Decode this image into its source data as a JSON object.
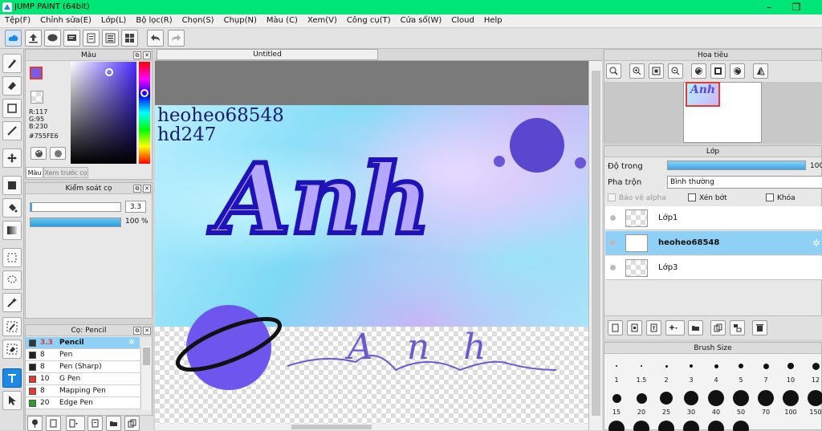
{
  "window": {
    "title": "JUMP PAINT (64bit)",
    "minimize": "–",
    "restore": "❐",
    "close": "✕"
  },
  "menu": [
    "Tệp(F)",
    "Chỉnh sửa(E)",
    "Lớp(L)",
    "Bộ lọc(R)",
    "Chọn(S)",
    "Chụp(N)",
    "Màu (C)",
    "Xem(V)",
    "Công cụ(T)",
    "Cửa sổ(W)",
    "Cloud",
    "Help"
  ],
  "color_panel": {
    "title": "Màu",
    "r": "R:117",
    "g": "G:95",
    "b": "B:230",
    "hex": "#755FE6",
    "tab_color": "Màu",
    "tab_preview": "Xem trước cọ",
    "main_color": "#755FE6"
  },
  "brush_control": {
    "title": "Kiểm soát cọ",
    "size": "3.3",
    "opacity": "100 %"
  },
  "brush_list": {
    "title": "Cọ: Pencil",
    "items": [
      {
        "size": "3.3",
        "name": "Pencil",
        "color": "#333333"
      },
      {
        "size": "8",
        "name": "Pen",
        "color": "#222222"
      },
      {
        "size": "8",
        "name": "Pen (Sharp)",
        "color": "#222222"
      },
      {
        "size": "10",
        "name": "G Pen",
        "color": "#e53935"
      },
      {
        "size": "8",
        "name": "Mapping Pen",
        "color": "#e53935"
      },
      {
        "size": "20",
        "name": "Edge Pen",
        "color": "#2e9d2e"
      }
    ]
  },
  "document": {
    "tab": "Untitled"
  },
  "artwork": {
    "line1": "heoheo68548",
    "line2": "hd247",
    "big_text": "Anh",
    "script_text": "Anh"
  },
  "navigator": {
    "title": "Hoa tiêu"
  },
  "layer_panel": {
    "title": "Lớp",
    "opacity_label": "Độ trong",
    "opacity_value": "100",
    "blend_label": "Pha trộn",
    "blend_value": "Bình thường",
    "protect_alpha": "Bảo vệ alpha",
    "clip": "Xén bớt",
    "lock": "Khóa",
    "layers": [
      {
        "name": "Lớp1",
        "selected": false
      },
      {
        "name": "heoheo68548",
        "selected": true
      },
      {
        "name": "Lớp3",
        "selected": false
      }
    ]
  },
  "brush_size": {
    "title": "Brush Size",
    "row1": [
      "1",
      "1.5",
      "2",
      "3",
      "4",
      "5",
      "7",
      "10",
      "12"
    ],
    "row2": [
      "15",
      "20",
      "25",
      "30",
      "40",
      "50",
      "70",
      "100",
      "150"
    ]
  }
}
